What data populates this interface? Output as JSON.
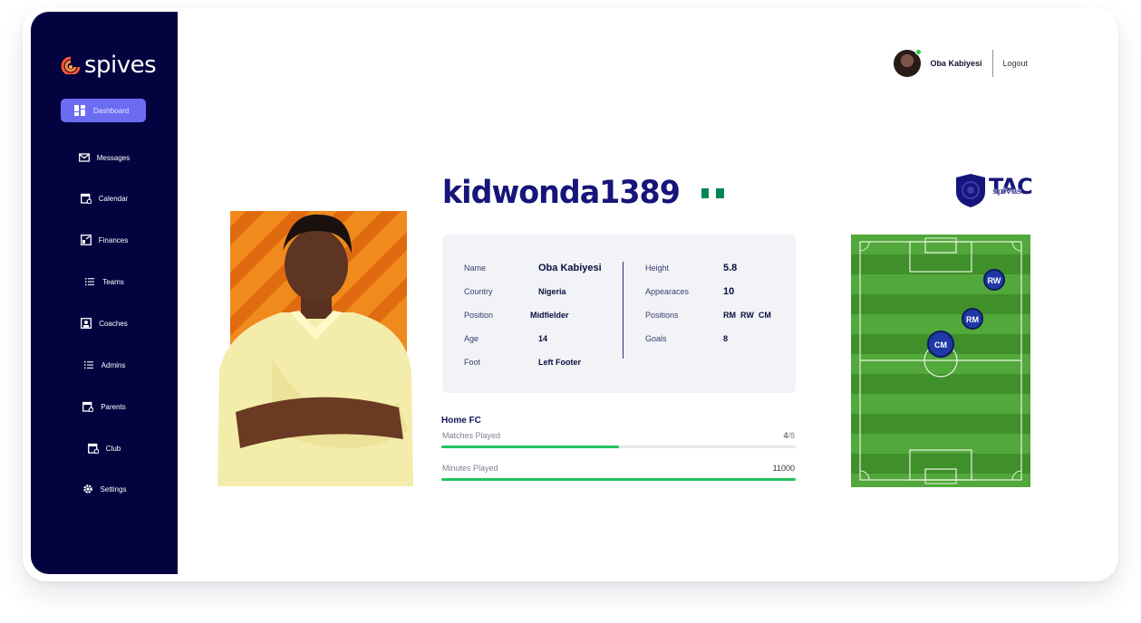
{
  "app": {
    "logo_text": "spives"
  },
  "header": {
    "user_name": "Oba Kabiyesi",
    "logout_label": "Logout"
  },
  "sidebar": {
    "items": [
      {
        "label": "Dashboard",
        "icon": "dashboard-icon",
        "active": true
      },
      {
        "label": "Messages",
        "icon": "mail-icon"
      },
      {
        "label": "Calendar",
        "icon": "calendar-icon"
      },
      {
        "label": "Finances",
        "icon": "finance-icon"
      },
      {
        "label": "Teams",
        "icon": "list-icon"
      },
      {
        "label": "Coaches",
        "icon": "coach-icon"
      },
      {
        "label": "Admins",
        "icon": "list-icon"
      },
      {
        "label": "Parents",
        "icon": "calendar-icon"
      },
      {
        "label": "Club",
        "icon": "calendar-icon"
      },
      {
        "label": "Settings",
        "icon": "gear-icon"
      }
    ]
  },
  "profile": {
    "username": "kidwonda1389",
    "flag_colors": [
      "#008751",
      "#ffffff",
      "#008751"
    ],
    "left": [
      {
        "label": "Name",
        "value": "Oba Kabiyesi"
      },
      {
        "label": "Country",
        "value": "Nigeria"
      },
      {
        "label": "Position",
        "value": "Midfielder"
      },
      {
        "label": "Age",
        "value": "14"
      },
      {
        "label": "Foot",
        "value": "Left Footer"
      }
    ],
    "right": [
      {
        "label": "Height",
        "value": "5.8"
      },
      {
        "label": "Appearaces",
        "value": "10"
      },
      {
        "label": "Positions",
        "value": "RM  RW  CM"
      },
      {
        "label": "Goals",
        "value": "8"
      }
    ]
  },
  "club": {
    "logo_main": "TAC",
    "logo_sub": "spives"
  },
  "pitch": {
    "markers": [
      "RW",
      "RM",
      "CM"
    ]
  },
  "stats": {
    "team": "Home FC",
    "rows": [
      {
        "label": "Matches Played",
        "value": "4",
        "suffix": "/8",
        "progress": 0.5
      },
      {
        "label": "Minutes Played",
        "value": "11000",
        "suffix": "",
        "progress": 1.0
      }
    ]
  },
  "colors": {
    "sidebar": "#03033f",
    "accent": "#6c6cf2",
    "progress": "#22c55e",
    "title": "#15157a"
  }
}
